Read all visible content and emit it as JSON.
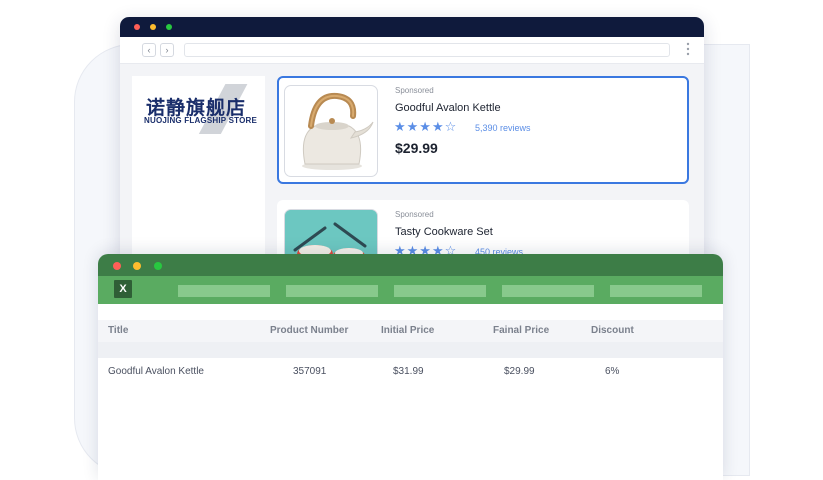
{
  "browser": {
    "nav": {
      "back_glyph": "‹",
      "forward_glyph": "›"
    },
    "store": {
      "logo_cn": "诺静旗舰店",
      "logo_en": "NUOJING FLAGSHIP STORE"
    },
    "products": [
      {
        "sponsored": "Sponsored",
        "title": "Goodful Avalon Kettle",
        "stars": "★★★★☆",
        "reviews": "5,390 reviews",
        "price": "$29.99",
        "selected": true,
        "image_icon": "kettle-image"
      },
      {
        "sponsored": "Sponsored",
        "title": "Tasty Cookware Set",
        "stars": "★★★★☆",
        "reviews": "450 reviews",
        "image_icon": "cookware-image"
      }
    ]
  },
  "spreadsheet": {
    "app_icon_label": "X",
    "headers": [
      "Title",
      "Product Number",
      "Initial Price",
      "Fainal Price",
      "Discount"
    ],
    "rows": [
      [
        "Goodful Avalon Kettle",
        "357091",
        "$31.99",
        "$29.99",
        "6%"
      ]
    ]
  },
  "colors": {
    "accent": "#3a78e0",
    "browser_bar": "#0f1a3c",
    "sheet_bar": "#3d7d47",
    "sheet_ribbon": "#5aab61",
    "star": "#5b8ee6"
  }
}
